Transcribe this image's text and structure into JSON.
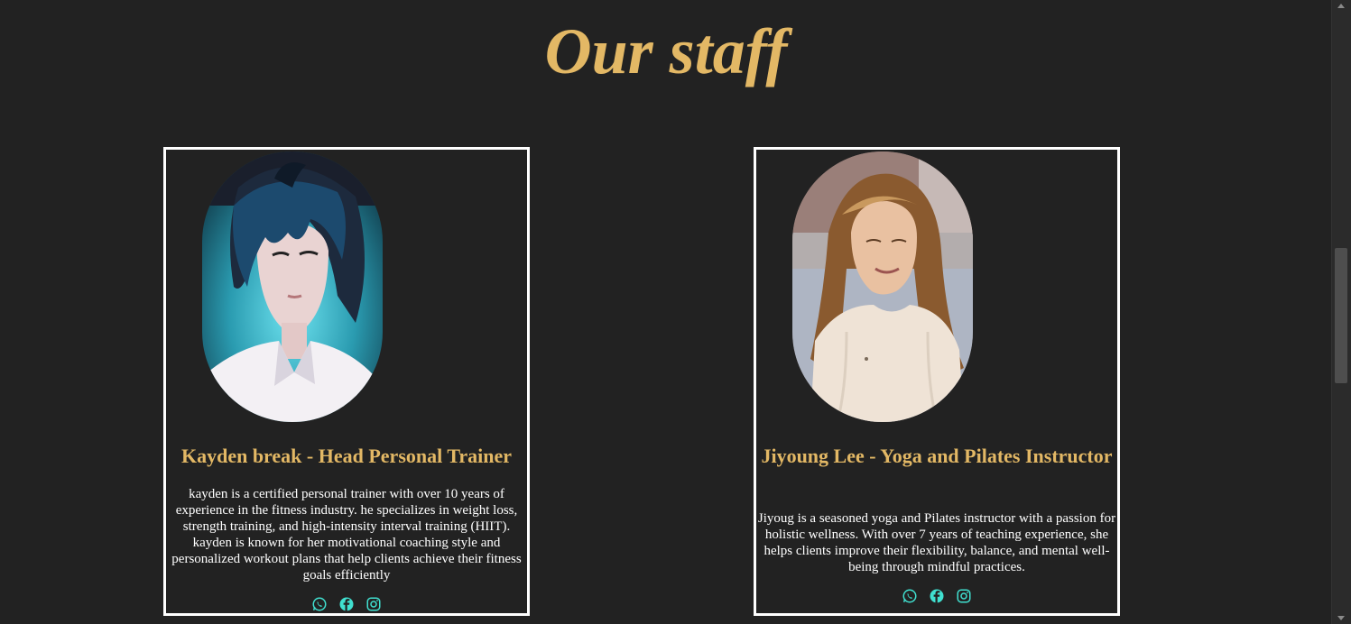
{
  "page": {
    "title": "Our staff",
    "accent_color": "#e3b865",
    "background_color": "#222222"
  },
  "staff": [
    {
      "photo_icon": "portrait-illustrated-man",
      "title": "Kayden break - Head Personal Trainer",
      "description": "kayden is a certified personal trainer with over 10 years of experience in the fitness industry. he specializes in weight loss, strength training, and high-intensity interval training (HIIT). kayden is known for her motivational coaching style and personalized workout plans that help clients achieve their fitness goals efficiently",
      "socials": [
        "whatsapp-icon",
        "facebook-icon",
        "instagram-icon"
      ]
    },
    {
      "photo_icon": "portrait-woman-photo",
      "title": "Jiyoung Lee - Yoga and Pilates Instructor",
      "description": "Jiyoug is a seasoned yoga and Pilates instructor with a passion for holistic wellness. With over 7 years of teaching experience, she helps clients improve their flexibility, balance, and mental well-being through mindful practices.",
      "socials": [
        "whatsapp-icon",
        "facebook-icon",
        "instagram-icon"
      ]
    }
  ],
  "social_icon_color": "#40e0d0"
}
